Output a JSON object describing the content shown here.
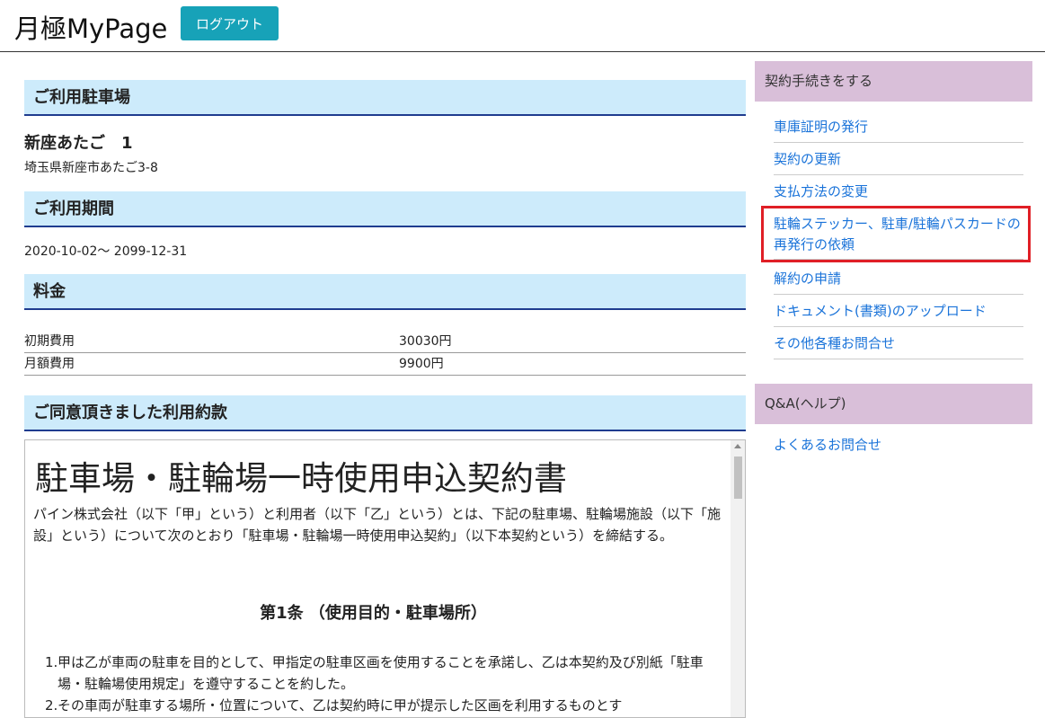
{
  "header": {
    "brand": "月極MyPage",
    "logout_label": "ログアウト"
  },
  "main": {
    "parking": {
      "heading": "ご利用駐車場",
      "name": "新座あたご　1",
      "address": "埼玉県新座市あたご3-8"
    },
    "period": {
      "heading": "ご利用期間",
      "value": "2020-10-02～ 2099-12-31"
    },
    "fees": {
      "heading": "料金",
      "rows": [
        {
          "label": "初期費用",
          "value": "30030円"
        },
        {
          "label": "月額費用",
          "value": "9900円"
        }
      ]
    },
    "terms": {
      "heading": "ご同意頂きました利用約款",
      "title": "駐車場・駐輪場一時使用申込契約書",
      "intro": "パイン株式会社（以下「甲」という）と利用者（以下「乙」という）とは、下記の駐車場、駐輪場施設（以下「施設」という）について次のとおり「駐車場・駐輪場一時使用申込契約」（以下本契約という）を締結する。",
      "article_title": "第1条 （使用目的・駐車場所）",
      "items": [
        {
          "num": "1.",
          "text": "甲は乙が車両の駐車を目的として、甲指定の駐車区画を使用することを承諾し、乙は本契約及び別紙「駐車場・駐輪場使用規定」を遵守することを約した。"
        },
        {
          "num": "2.",
          "text": "その車両が駐車する場所・位置について、乙は契約時に甲が提示した区画を利用するものとす"
        }
      ]
    }
  },
  "sidebar": {
    "procedures": {
      "heading": "契約手続きをする",
      "items": [
        "車庫証明の発行",
        "契約の更新",
        "支払方法の変更",
        "駐輪ステッカー、駐車/駐輪パスカードの再発行の依頼",
        "解約の申請",
        "ドキュメント(書類)のアップロード",
        "その他各種お問合せ"
      ]
    },
    "help": {
      "heading": "Q&A(ヘルプ)",
      "items": [
        "よくあるお問合せ"
      ]
    }
  },
  "colors": {
    "accent": "#17a2b8",
    "section_bg": "#cdebfb",
    "sidebar_bg": "#d9bfd9",
    "link": "#1a73d9",
    "highlight": "#e01f26"
  }
}
